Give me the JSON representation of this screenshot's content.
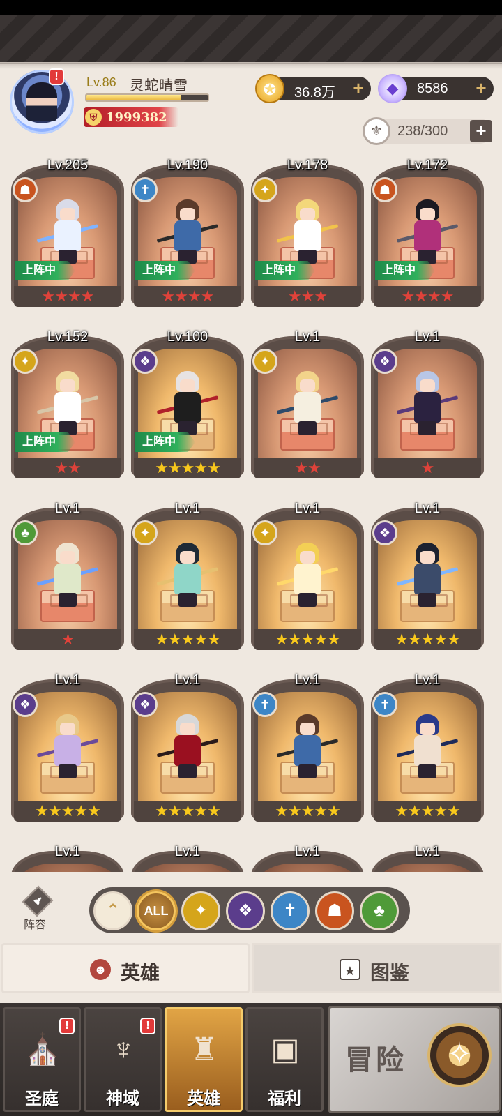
{
  "player": {
    "level": "Lv.86",
    "name": "灵蛇晴雪",
    "power": "1999382",
    "exp_progress": 0.78,
    "avatar_alert": "!"
  },
  "currencies": {
    "gold": "36.8万",
    "gems": "8586",
    "stamina": "238/300",
    "plus": "+"
  },
  "deploy_label": "上阵中",
  "heroes": [
    {
      "level": "Lv.205",
      "faction": "fire-icon",
      "stars": "★★★★",
      "star_color": "red",
      "deployed": true
    },
    {
      "level": "Lv.190",
      "faction": "ice-icon",
      "stars": "★★★★",
      "star_color": "red",
      "deployed": true
    },
    {
      "level": "Lv.178",
      "faction": "holy-icon",
      "stars": "★★★",
      "star_color": "red",
      "deployed": true
    },
    {
      "level": "Lv.172",
      "faction": "fire-icon",
      "stars": "★★★★",
      "star_color": "red",
      "deployed": true
    },
    {
      "level": "Lv.152",
      "faction": "holy-icon",
      "stars": "★★",
      "star_color": "red",
      "deployed": true
    },
    {
      "level": "Lv.100",
      "faction": "shadow-icon",
      "stars": "★★★★★",
      "star_color": "gold",
      "deployed": true
    },
    {
      "level": "Lv.1",
      "faction": "holy-icon",
      "stars": "★★",
      "star_color": "red",
      "deployed": false
    },
    {
      "level": "Lv.1",
      "faction": "shadow-icon",
      "stars": "★",
      "star_color": "red",
      "deployed": false
    },
    {
      "level": "Lv.1",
      "faction": "nature-icon",
      "stars": "★",
      "star_color": "red",
      "deployed": false
    },
    {
      "level": "Lv.1",
      "faction": "holy-icon",
      "stars": "★★★★★",
      "star_color": "gold",
      "deployed": false
    },
    {
      "level": "Lv.1",
      "faction": "holy-icon",
      "stars": "★★★★★",
      "star_color": "gold",
      "deployed": false
    },
    {
      "level": "Lv.1",
      "faction": "shadow-icon",
      "stars": "★★★★★",
      "star_color": "gold",
      "deployed": false
    },
    {
      "level": "Lv.1",
      "faction": "shadow-icon",
      "stars": "★★★★★",
      "star_color": "gold",
      "deployed": false
    },
    {
      "level": "Lv.1",
      "faction": "shadow-icon",
      "stars": "★★★★★",
      "star_color": "gold",
      "deployed": false
    },
    {
      "level": "Lv.1",
      "faction": "ice-icon",
      "stars": "★★★★★",
      "star_color": "gold",
      "deployed": false
    },
    {
      "level": "Lv.1",
      "faction": "ice-icon",
      "stars": "★★★★★",
      "star_color": "gold",
      "deployed": false
    },
    {
      "level": "Lv.1",
      "faction": "",
      "stars": "",
      "star_color": "",
      "deployed": false
    },
    {
      "level": "Lv.1",
      "faction": "",
      "stars": "",
      "star_color": "",
      "deployed": false
    },
    {
      "level": "Lv.1",
      "faction": "",
      "stars": "",
      "star_color": "",
      "deployed": false
    },
    {
      "level": "Lv.1",
      "faction": "",
      "stars": "",
      "star_color": "",
      "deployed": false
    }
  ],
  "filters": {
    "lineup_label": "阵容",
    "all_label": "ALL",
    "items": [
      "collapse-icon",
      "all",
      "holy-icon",
      "shadow-icon",
      "ice-icon",
      "fire-icon",
      "nature-icon"
    ]
  },
  "subtabs": {
    "heroes": "英雄",
    "codex": "图鉴"
  },
  "nav": {
    "items": [
      {
        "label": "圣庭",
        "icon": "sanctum-icon",
        "alert": "!"
      },
      {
        "label": "神域",
        "icon": "divine-realm-icon",
        "alert": "!"
      },
      {
        "label": "英雄",
        "icon": "hero-helmet-icon",
        "alert": ""
      },
      {
        "label": "福利",
        "icon": "treasure-chest-icon",
        "alert": ""
      }
    ],
    "adventure": "冒险"
  },
  "colors": {
    "fire": "#c9541f",
    "ice": "#3d86c6",
    "holy": "#d5a51b",
    "shadow": "#5b3d8c",
    "nature": "#4f9a38",
    "deploy_green": "#2fb05c",
    "star_red": "#e0423a",
    "star_gold": "#f8c81c"
  }
}
